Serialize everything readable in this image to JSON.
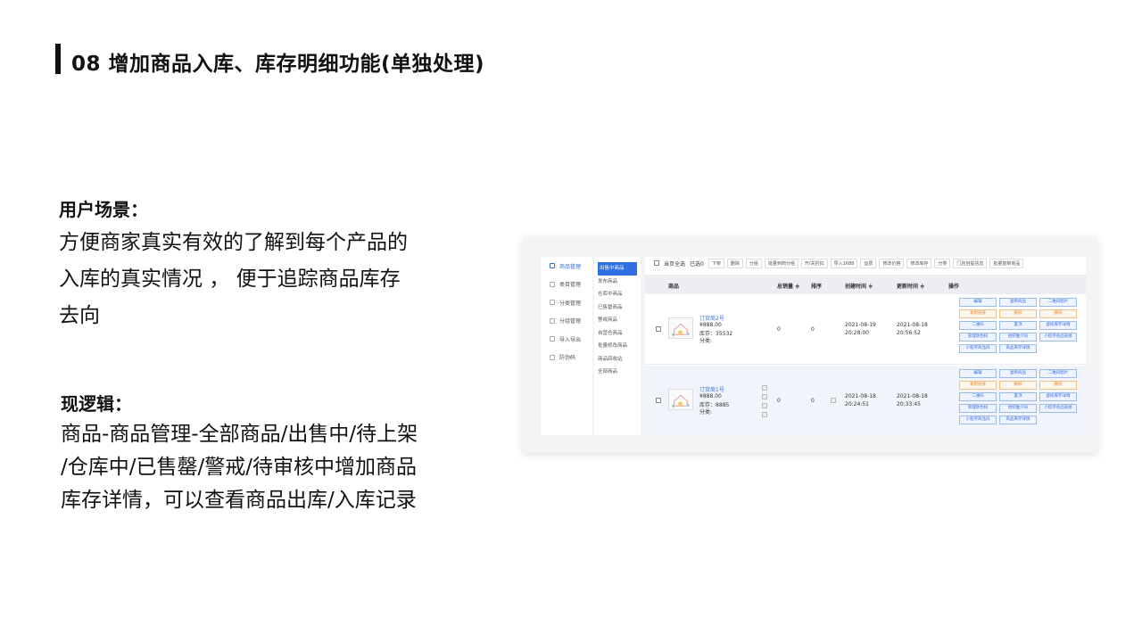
{
  "slide": {
    "title": "08 增加商品入库、库存明细功能(单独处理)",
    "scenario_heading": "用户场景：",
    "scenario_lines": [
      "方便商家真实有效的了解到每个产品的",
      "入库的真实情况 ， 便于追踪商品库存",
      "去向"
    ],
    "logic_heading": "现逻辑：",
    "logic_lines": [
      "商品-商品管理-全部商品/出售中/待上架",
      "/仓库中/已售罄/警戒/待审核中增加商品",
      "库存详情，可以查看商品出库/入库记录"
    ]
  },
  "screenshot": {
    "sidebar_primary": [
      "商品管理",
      "类目管理",
      "分类管理",
      "分组管理",
      "导入导出",
      "防伪码"
    ],
    "sidebar_secondary": [
      "出售中商品",
      "发布商品",
      "仓库中商品",
      "已售罄商品",
      "警戒商品",
      "自营仓商品",
      "批量修改商品",
      "商品回收站",
      "全部商品"
    ],
    "toolbar": {
      "select_label": "当页全选",
      "selected_label": "已选0",
      "buttons": [
        "下架",
        "删除",
        "分组",
        "批量到岗分组",
        "开/关折扣",
        "导入1688",
        "运费",
        "修改价格",
        "修改库存",
        "分类",
        "门店自提信息",
        "批量复制商品"
      ]
    },
    "table_headers": {
      "product": "商品",
      "sales": "总销量 ≑",
      "sort": "排序",
      "created": "创建时间 ≑",
      "updated": "更新时间 ≑",
      "actions": "操作"
    },
    "rows": [
      {
        "name": "订货商2号",
        "price": "¥888.00",
        "stock": "库存：35532",
        "category": "分类:",
        "sales": "0",
        "sort": "0",
        "created_date": "2021-08-19",
        "created_time": "20:28:00",
        "updated_date": "2021-08-18",
        "updated_time": "20:56:52",
        "actions": [
          "编辑",
          "复制商品",
          "二维码图片",
          "复制链接",
          "删除",
          "删除",
          "二维码",
          "置顶",
          "虚拟库存详情",
          "管理防伪码",
          "组织推介码",
          "小程序商品链接",
          "小程序商品码",
          "商品库存详情"
        ]
      },
      {
        "name": "订货商1号",
        "price": "¥888.00",
        "stock": "库存：8885",
        "category": "分类:",
        "sales": "0",
        "sort": "0",
        "created_date": "2021-08-18",
        "created_time": "20:24:51",
        "updated_date": "2021-08-18",
        "updated_time": "20:33:45",
        "actions": [
          "编辑",
          "复制商品",
          "二维码图片",
          "复制链接",
          "删除",
          "删除",
          "二维码",
          "置顶",
          "虚拟库存详情",
          "管理防伪码",
          "组织推介码",
          "小程序商品链接",
          "小程序商品码",
          "商品库存详情"
        ]
      }
    ]
  }
}
